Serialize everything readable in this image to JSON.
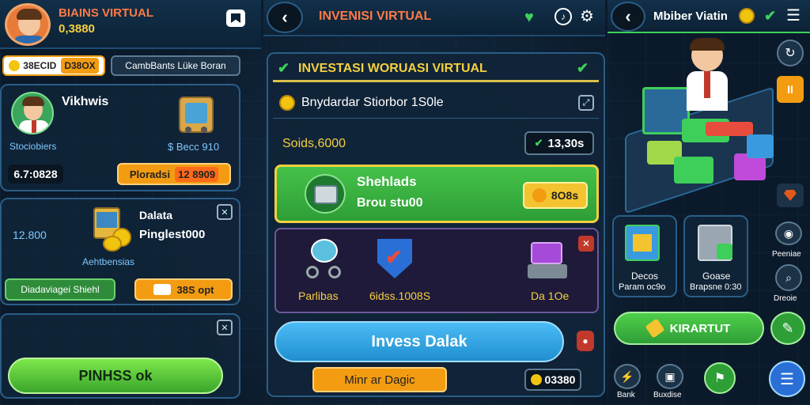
{
  "left": {
    "header": {
      "title": "BIAINS VIRTUAL",
      "balance": "0,3880"
    },
    "tabs": {
      "active": "38ECID",
      "active_value": "D38OX",
      "other": "CambBants Lüke Boran"
    },
    "card1": {
      "name": "Vikhwis",
      "sub": "Stociobiers",
      "price": "$ Becc 910",
      "id": "6.7:0828",
      "btn_label": "Ploradsi",
      "btn_value": "12 8909"
    },
    "card2": {
      "title": "Dalata",
      "value": "Pinglest000",
      "left_value": "12.800",
      "sub": "Aehtbensias",
      "btn_green": "Diadaviagei Shiehl",
      "btn_orange": "38S opt"
    },
    "main_btn": "PINHSS ok"
  },
  "mid": {
    "header_title": "INVENISI VIRTUAL",
    "banner": "INVESTASI WORUASI VIRTUAL",
    "row1": "Bnydardar Stiorbor 1S0le",
    "row2_left": "Soids,6000",
    "row2_right": "13,30s",
    "green": {
      "title": "Shehlads",
      "sub": "Brou stu00",
      "btn": "8O8s"
    },
    "items": [
      {
        "label": "Parlibas"
      },
      {
        "label": "6idss.1008S"
      },
      {
        "label": "Da 1Oe"
      }
    ],
    "invest_btn": "Invess Dalak",
    "bottom_btn": "Minr ar Dagic",
    "bottom_value": "03380"
  },
  "right": {
    "header_title": "Mbiber Viatin",
    "cards": [
      {
        "title": "Decos",
        "sub": "Param oc9o"
      },
      {
        "title": "Goase",
        "sub": "Brapsne 0:30"
      }
    ],
    "side": [
      "Peeniae",
      "Dreoie"
    ],
    "kirart": "KIRARTUT",
    "bottom": [
      "Bank",
      "Buxdise"
    ]
  }
}
